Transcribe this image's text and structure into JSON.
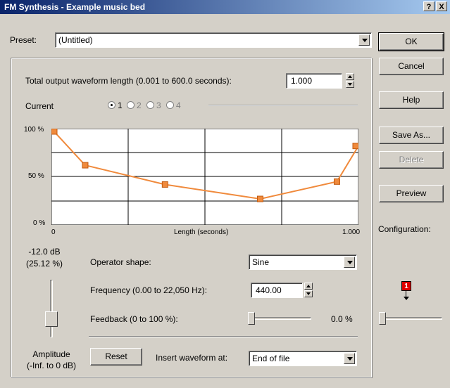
{
  "window": {
    "title": "FM Synthesis - Example music bed",
    "help_btn": "?",
    "close_btn": "X"
  },
  "preset": {
    "label": "Preset:",
    "value": "(Untitled)"
  },
  "buttons": {
    "ok": "OK",
    "cancel": "Cancel",
    "help": "Help",
    "save_as": "Save As...",
    "delete": "Delete",
    "preview": "Preview"
  },
  "total_length": {
    "label": "Total output waveform length (0.001 to 600.0 seconds):",
    "value": "1.000"
  },
  "current": {
    "label": "Current",
    "options": [
      "1",
      "2",
      "3",
      "4"
    ],
    "selected": "1"
  },
  "envelope": {
    "y_labels": [
      "100 %",
      "50 %",
      "0 %"
    ],
    "x_left": "0",
    "x_center": "Length (seconds)",
    "x_right": "1.000",
    "line_color": "#f08a3c"
  },
  "chart_data": {
    "type": "line",
    "xlabel": "Length (seconds)",
    "xlim": [
      0,
      1.0
    ],
    "ylim": [
      0,
      100
    ],
    "series": [
      {
        "x": [
          0.0,
          0.11,
          0.37,
          0.68,
          0.93,
          1.0
        ],
        "values": [
          100,
          62,
          42,
          27,
          45,
          82
        ]
      }
    ]
  },
  "amplitude": {
    "value_db": "-12.0 dB",
    "value_pct": "(25.12 %)",
    "label1": "Amplitude",
    "label2": "(-Inf. to 0 dB)",
    "level": 0.25
  },
  "operator_shape": {
    "label": "Operator shape:",
    "value": "Sine"
  },
  "frequency": {
    "label": "Frequency (0.00 to 22,050 Hz):",
    "value": "440.00"
  },
  "feedback": {
    "label": "Feedback (0 to 100 %):",
    "value": "0.0 %",
    "level": 0
  },
  "reset_btn": "Reset",
  "insert": {
    "label": "Insert waveform at:",
    "value": "End of file"
  },
  "configuration": {
    "label": "Configuration:",
    "marker": "1",
    "level": 0
  }
}
